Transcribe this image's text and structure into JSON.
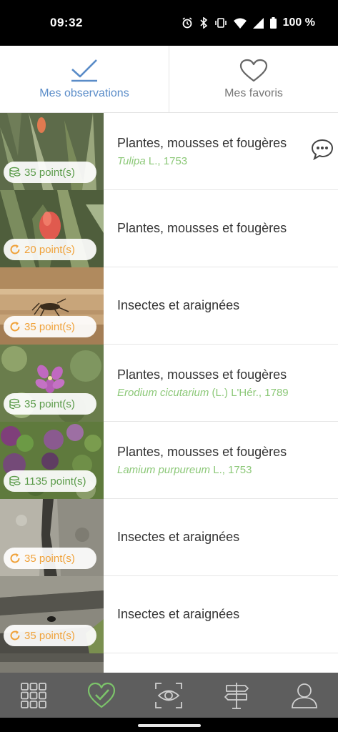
{
  "status_bar": {
    "time": "09:32",
    "battery": "100 %",
    "icons": [
      "alarm-icon",
      "bluetooth-icon",
      "vibrate-icon",
      "wifi-icon",
      "signal-icon",
      "battery-icon"
    ]
  },
  "tabs": [
    {
      "label": "Mes observations",
      "icon": "checkmark-icon",
      "active": true
    },
    {
      "label": "Mes favoris",
      "icon": "heart-icon",
      "active": false
    }
  ],
  "observations": [
    {
      "group": "Plantes, mousses et fougères",
      "species_name": "Tulipa",
      "species_author": " L., 1753",
      "points": "35 point(s)",
      "points_icon": "coins-icon",
      "points_color": "#5b9b4a",
      "has_comment": true
    },
    {
      "group": "Plantes, mousses et fougères",
      "species_name": "",
      "species_author": "",
      "points": "20 point(s)",
      "points_icon": "refresh-icon",
      "points_color": "#f0a23a",
      "has_comment": false
    },
    {
      "group": "Insectes et araignées",
      "species_name": "",
      "species_author": "",
      "points": "35 point(s)",
      "points_icon": "refresh-icon",
      "points_color": "#f0a23a",
      "has_comment": false
    },
    {
      "group": "Plantes, mousses et fougères",
      "species_name": "Erodium cicutarium",
      "species_author": " (L.) L'Hér., 1789",
      "points": "35 point(s)",
      "points_icon": "coins-icon",
      "points_color": "#5b9b4a",
      "has_comment": false
    },
    {
      "group": "Plantes, mousses et fougères",
      "species_name": "Lamium purpureum",
      "species_author": " L., 1753",
      "points": "1135 point(s)",
      "points_icon": "coins-icon",
      "points_color": "#5b9b4a",
      "has_comment": false
    },
    {
      "group": "Insectes et araignées",
      "species_name": "",
      "species_author": "",
      "points": "35 point(s)",
      "points_icon": "refresh-icon",
      "points_color": "#f0a23a",
      "has_comment": false
    },
    {
      "group": "Insectes et araignées",
      "species_name": "",
      "species_author": "",
      "points": "35 point(s)",
      "points_icon": "refresh-icon",
      "points_color": "#f0a23a",
      "has_comment": false
    }
  ],
  "bottom_nav": {
    "items": [
      "grid-icon",
      "heart-check-icon",
      "eye-scan-icon",
      "signpost-icon",
      "user-icon"
    ],
    "active": "heart-check-icon",
    "background": "#5e5e5e",
    "active_color": "#7cc36a"
  }
}
